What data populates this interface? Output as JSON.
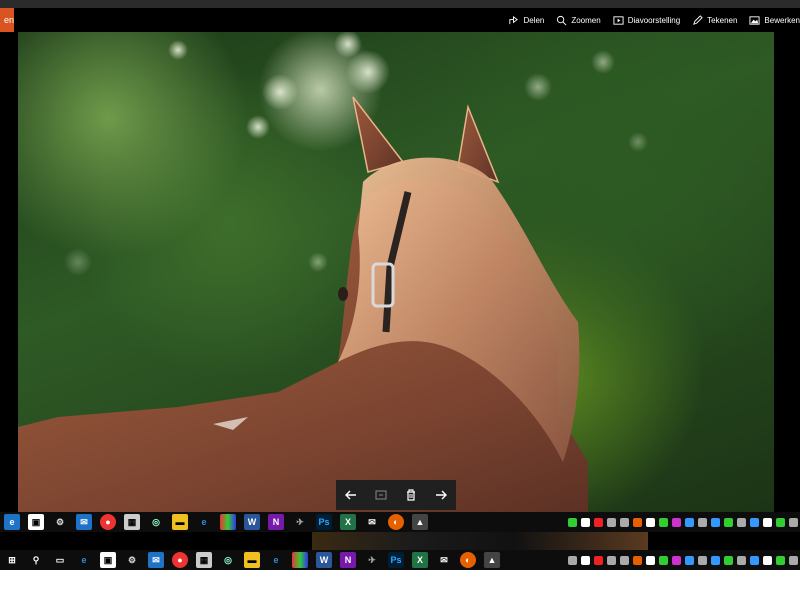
{
  "window": {
    "orange_tab_label": "en"
  },
  "commandbar": {
    "items": [
      {
        "label": "Delen",
        "icon": "share-icon"
      },
      {
        "label": "Zoomen",
        "icon": "zoom-icon"
      },
      {
        "label": "Diavoorstelling",
        "icon": "slideshow-icon"
      },
      {
        "label": "Tekenen",
        "icon": "draw-icon"
      },
      {
        "label": "Bewerken",
        "icon": "edit-icon"
      }
    ]
  },
  "viewer_controls": {
    "items": [
      "previous-arrow-icon",
      "slideshow-icon",
      "delete-icon",
      "next-arrow-icon"
    ]
  },
  "colors": {
    "accent_orange": "#d9541e",
    "background": "#000000",
    "taskbar": "#0d0d0d"
  },
  "taskbar_icons": [
    "ie-icon",
    "store-icon",
    "settings-icon",
    "mail-icon",
    "chrome-icon",
    "calculator-icon",
    "app-icon",
    "explorer-icon",
    "edge-icon",
    "paint-icon",
    "word-icon",
    "onenote-icon",
    "unknown-icon",
    "photoshop-icon",
    "excel-icon",
    "mail2-icon",
    "firefox-icon",
    "photos-icon"
  ]
}
